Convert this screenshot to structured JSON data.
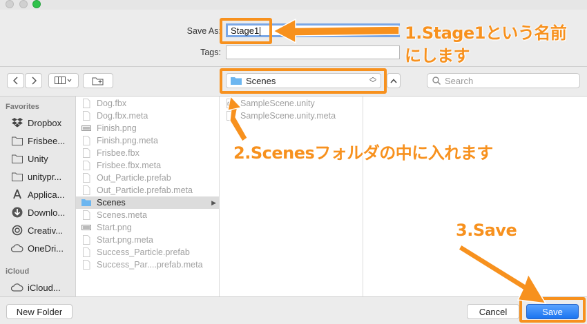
{
  "form": {
    "save_as_label": "Save As:",
    "save_as_value": "Stage1",
    "tags_label": "Tags:"
  },
  "toolbar": {
    "location": "Scenes",
    "search_placeholder": "Search"
  },
  "sidebar": {
    "favorites_header": "Favorites",
    "favorites": [
      {
        "label": "Dropbox",
        "icon": "dropbox-icon"
      },
      {
        "label": "Frisbee...",
        "icon": "folder-icon"
      },
      {
        "label": "Unity",
        "icon": "folder-icon"
      },
      {
        "label": "unitypr...",
        "icon": "folder-icon"
      },
      {
        "label": "Applica...",
        "icon": "applications-icon"
      },
      {
        "label": "Downlo...",
        "icon": "downloads-icon"
      },
      {
        "label": "Creativ...",
        "icon": "creative-cloud-icon"
      },
      {
        "label": "OneDri...",
        "icon": "cloud-icon"
      }
    ],
    "icloud_header": "iCloud",
    "icloud": [
      {
        "label": "iCloud...",
        "icon": "cloud-icon"
      }
    ]
  },
  "column1": [
    {
      "label": "Dog.fbx",
      "icon": "file-icon"
    },
    {
      "label": "Dog.fbx.meta",
      "icon": "file-icon"
    },
    {
      "label": "Finish.png",
      "icon": "image-file-icon"
    },
    {
      "label": "Finish.png.meta",
      "icon": "file-icon"
    },
    {
      "label": "Frisbee.fbx",
      "icon": "file-icon"
    },
    {
      "label": "Frisbee.fbx.meta",
      "icon": "file-icon"
    },
    {
      "label": "Out_Particle.prefab",
      "icon": "file-icon"
    },
    {
      "label": "Out_Particle.prefab.meta",
      "icon": "file-icon"
    },
    {
      "label": "Scenes",
      "icon": "folder-icon"
    },
    {
      "label": "Scenes.meta",
      "icon": "file-icon"
    },
    {
      "label": "Start.png",
      "icon": "image-file-icon"
    },
    {
      "label": "Start.png.meta",
      "icon": "file-icon"
    },
    {
      "label": "Success_Particle.prefab",
      "icon": "file-icon"
    },
    {
      "label": "Success_Par....prefab.meta",
      "icon": "file-icon"
    }
  ],
  "column2": [
    {
      "label": "SampleScene.unity",
      "icon": "unity-file-icon"
    },
    {
      "label": "SampleScene.unity.meta",
      "icon": "file-icon"
    }
  ],
  "footer": {
    "new_folder": "New Folder",
    "cancel": "Cancel",
    "save": "Save"
  },
  "annotations": {
    "step1_line1": "1.Stage1という名前",
    "step1_line2": "にします",
    "step2": "2.Scenesフォルダの中に入れます",
    "step3": "3.Save"
  },
  "colors": {
    "annotation": "#f7911e",
    "accent": "#1a74f0",
    "folder": "#6cb6f0"
  }
}
